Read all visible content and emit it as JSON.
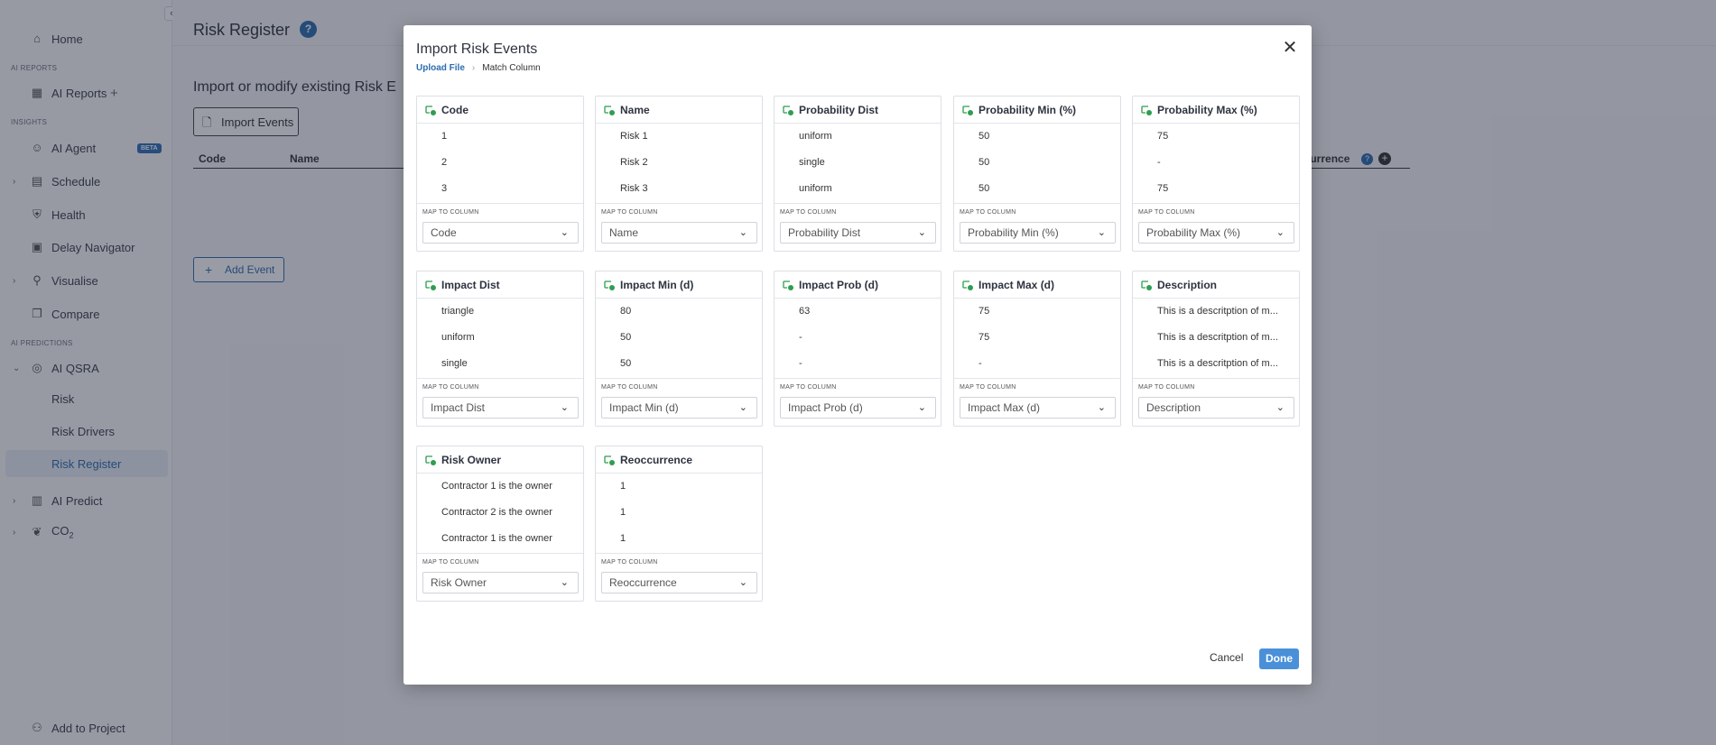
{
  "sidebar": {
    "collapse_glyph": "‹",
    "items": [
      {
        "label": "Home",
        "icon": "⌂"
      },
      {
        "label": "AI Reports",
        "icon": "▦"
      },
      {
        "label": "AI Agent",
        "icon": "☺"
      },
      {
        "label": "Schedule",
        "icon": "▤"
      },
      {
        "label": "Health",
        "icon": "⛨"
      },
      {
        "label": "Delay Navigator",
        "icon": "▣"
      },
      {
        "label": "Visualise",
        "icon": "⚲"
      },
      {
        "label": "Compare",
        "icon": "❐"
      },
      {
        "label": "AI QSRA",
        "icon": "◎"
      },
      {
        "label": "Risk"
      },
      {
        "label": "Risk Drivers"
      },
      {
        "label": "Risk Register"
      },
      {
        "label": "AI Predict",
        "icon": "▥"
      },
      {
        "label": "CO",
        "sub": "2",
        "icon": "❦"
      },
      {
        "label": "Add to Project",
        "icon": "⚇"
      }
    ],
    "sections": {
      "ai_reports": "AI REPORTS",
      "insights": "INSIGHTS",
      "ai_predictions": "AI PREDICTIONS"
    },
    "beta_label": "BETA"
  },
  "page": {
    "title": "Risk Register",
    "help": "?",
    "subtitle": "Import or modify existing Risk E",
    "import_button": "Import Events",
    "columns": [
      "Code",
      "Name"
    ],
    "reoccurrence_header": "ccurrence",
    "add_event_button": "Add Event"
  },
  "modal": {
    "title": "Import Risk Events",
    "close": "✕",
    "breadcrumb": {
      "step1": "Upload File",
      "sep": "›",
      "step2": "Match Column"
    },
    "map_label": "MAP TO COLUMN",
    "cards": [
      {
        "title": "Code",
        "rows": [
          "1",
          "2",
          "3"
        ],
        "selected": "Code"
      },
      {
        "title": "Name",
        "rows": [
          "Risk 1",
          "Risk 2",
          "Risk 3"
        ],
        "selected": "Name"
      },
      {
        "title": "Probability Dist",
        "rows": [
          "uniform",
          "single",
          "uniform"
        ],
        "selected": "Probability Dist"
      },
      {
        "title": "Probability Min (%)",
        "rows": [
          "50",
          "50",
          "50"
        ],
        "selected": "Probability Min (%)"
      },
      {
        "title": "Probability Max (%)",
        "rows": [
          "75",
          "-",
          "75"
        ],
        "selected": "Probability Max (%)"
      },
      {
        "title": "Impact Dist",
        "rows": [
          "triangle",
          "uniform",
          "single"
        ],
        "selected": "Impact Dist"
      },
      {
        "title": "Impact Min (d)",
        "rows": [
          "80",
          "50",
          "50"
        ],
        "selected": "Impact Min (d)"
      },
      {
        "title": "Impact Prob (d)",
        "rows": [
          "63",
          "-",
          "-"
        ],
        "selected": "Impact Prob (d)"
      },
      {
        "title": "Impact Max (d)",
        "rows": [
          "75",
          "75",
          "-"
        ],
        "selected": "Impact Max (d)"
      },
      {
        "title": "Description",
        "rows": [
          "This is a descritption of m...",
          "This is a descritption of m...",
          "This is a descritption of m..."
        ],
        "selected": "Description"
      },
      {
        "title": "Risk Owner",
        "rows": [
          "Contractor 1 is the owner",
          "Contractor 2 is the owner",
          "Contractor 1 is the owner"
        ],
        "selected": "Risk Owner"
      },
      {
        "title": "Reoccurrence",
        "rows": [
          "1",
          "1",
          "1"
        ],
        "selected": "Reoccurrence"
      }
    ],
    "cancel_button": "Cancel",
    "done_button": "Done"
  },
  "colors": {
    "accent": "#2b6cb0",
    "done": "#4a90d9",
    "map_icon": "#2e9e4f"
  }
}
